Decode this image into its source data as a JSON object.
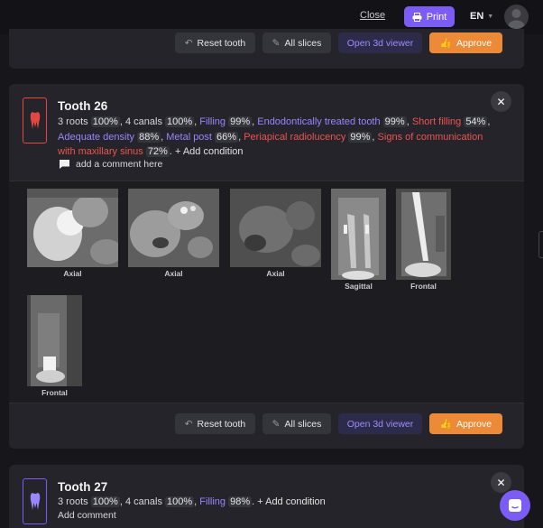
{
  "topbar": {
    "close_label": "Close",
    "print_label": "Print",
    "lang_label": "EN"
  },
  "card_prev": {
    "actions": {
      "reset": "Reset tooth",
      "slices": "All slices",
      "viewer": "Open 3d viewer",
      "approve": "Approve"
    }
  },
  "tooth26": {
    "title": "Tooth 26",
    "roots": "3 roots",
    "roots_pct": "100%",
    "canals": "4 canals",
    "canals_pct": "100%",
    "filling": "Filling",
    "filling_pct": "99%",
    "endo": "Endodontically treated tooth",
    "endo_pct": "99%",
    "short_filling": "Short filling",
    "short_filling_pct": "54%",
    "density": "Adequate density",
    "density_pct": "88%",
    "metal_post": "Metal post",
    "metal_post_pct": "66%",
    "periapical": "Periapical radiolucency",
    "periapical_pct": "99%",
    "sinus": "Signs of communication with maxillary sinus",
    "sinus_pct": "72%",
    "add_condition": "+ Add condition",
    "comment": "add a comment here",
    "slices": [
      {
        "label": "Axial"
      },
      {
        "label": "Axial"
      },
      {
        "label": "Axial"
      },
      {
        "label": "Sagittal"
      },
      {
        "label": "Frontal"
      },
      {
        "label": "Frontal"
      }
    ],
    "actions": {
      "reset": "Reset tooth",
      "slices": "All slices",
      "viewer": "Open 3d viewer",
      "approve": "Approve"
    }
  },
  "tooth27": {
    "title": "Tooth 27",
    "roots": "3 roots",
    "roots_pct": "100%",
    "canals": "4 canals",
    "canals_pct": "100%",
    "filling": "Filling",
    "filling_pct": "98%",
    "add_condition": "+ Add condition",
    "comment": "Add comment"
  },
  "colors": {
    "accent": "#7b5cf5",
    "approve": "#ed8a37",
    "danger": "#ef5353",
    "condition": "#9a86ff"
  }
}
